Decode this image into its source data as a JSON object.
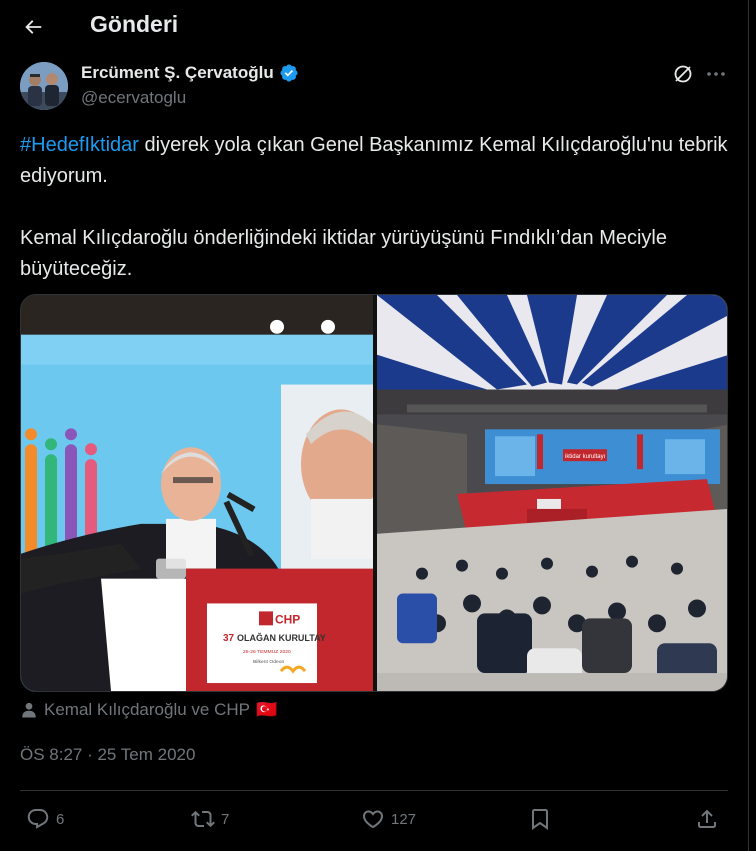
{
  "header": {
    "title": "Gönderi"
  },
  "author": {
    "name": "Ercüment Ş. Çervatoğlu",
    "handle": "@ecervatoglu"
  },
  "tweet": {
    "hashtag": "#HedefIktidar",
    "line1_rest": " diyerek yola çıkan Genel Başkanımız Kemal Kılıçdaroğlu'nu tebrik ediyorum.",
    "para2": "Kemal Kılıçdaroğlu önderliğindeki iktidar yürüyüşünü Fındıklı’dan Meciyle büyüteceğiz."
  },
  "media": {
    "left_photo": {
      "banner_logo": "CHP",
      "banner_line1": "37",
      "banner_line2": "OLAĞAN KURULTAY",
      "banner_line3": "25-26 TEMMUZ 2020",
      "banner_line4": "Bilkent Odeon"
    },
    "right_photo": {
      "screen_text": "iktidar kurultayı"
    }
  },
  "tags": {
    "text": "Kemal Kılıçdaroğlu ve CHP",
    "flag": "🇹🇷"
  },
  "timestamp": "ÖS 8:27 · 25 Tem 2020",
  "actions": {
    "replies": "6",
    "retweets": "7",
    "likes": "127"
  },
  "colors": {
    "background": "#000000",
    "text": "#e7e9ea",
    "muted": "#71767b",
    "accent": "#1d9bf0",
    "border": "#2f3336"
  },
  "icons": [
    "back-arrow-icon",
    "verified-badge-icon",
    "grok-icon",
    "more-icon",
    "person-icon",
    "reply-icon",
    "retweet-icon",
    "like-icon",
    "bookmark-icon",
    "share-icon"
  ]
}
